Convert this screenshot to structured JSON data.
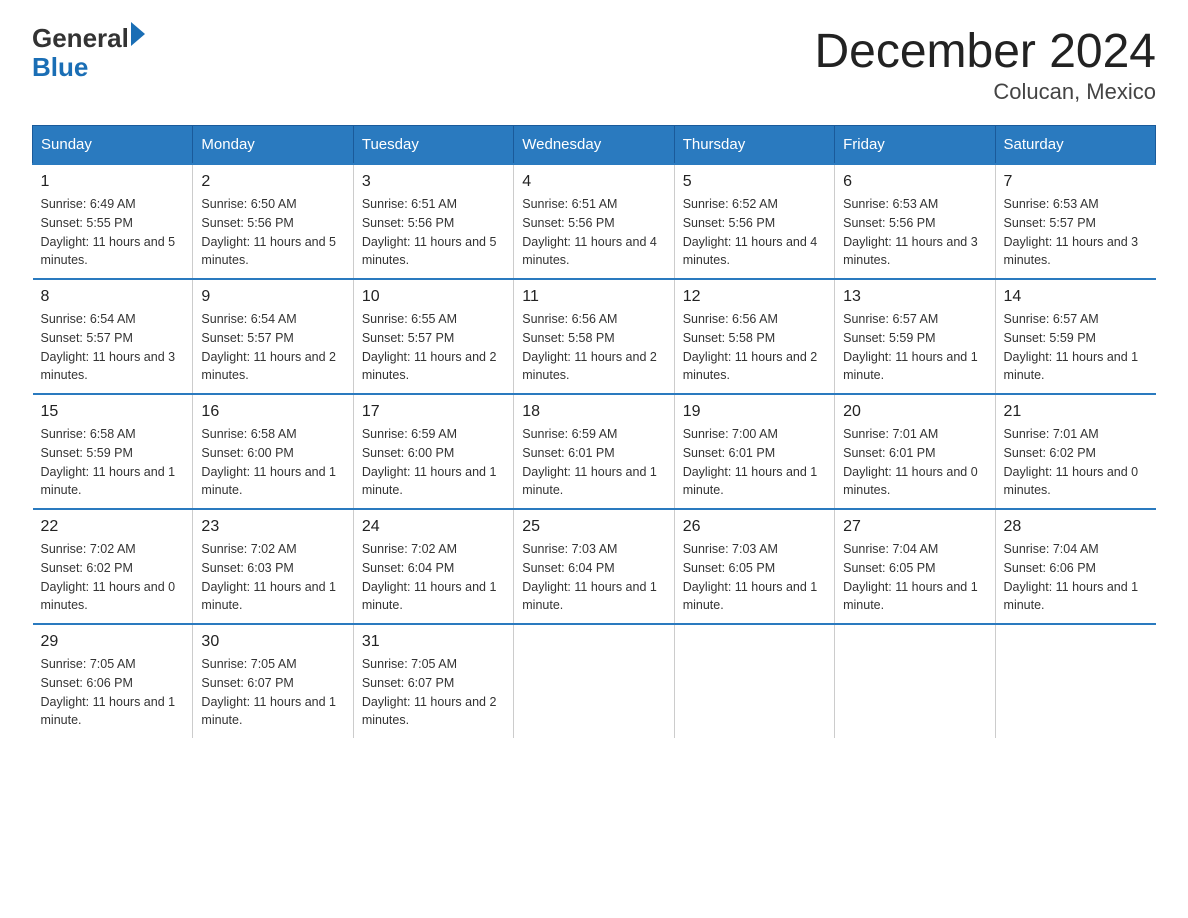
{
  "logo": {
    "general": "General",
    "blue": "Blue"
  },
  "title": "December 2024",
  "subtitle": "Colucan, Mexico",
  "days_of_week": [
    "Sunday",
    "Monday",
    "Tuesday",
    "Wednesday",
    "Thursday",
    "Friday",
    "Saturday"
  ],
  "weeks": [
    [
      {
        "num": "1",
        "sunrise": "6:49 AM",
        "sunset": "5:55 PM",
        "daylight": "11 hours and 5 minutes."
      },
      {
        "num": "2",
        "sunrise": "6:50 AM",
        "sunset": "5:56 PM",
        "daylight": "11 hours and 5 minutes."
      },
      {
        "num": "3",
        "sunrise": "6:51 AM",
        "sunset": "5:56 PM",
        "daylight": "11 hours and 5 minutes."
      },
      {
        "num": "4",
        "sunrise": "6:51 AM",
        "sunset": "5:56 PM",
        "daylight": "11 hours and 4 minutes."
      },
      {
        "num": "5",
        "sunrise": "6:52 AM",
        "sunset": "5:56 PM",
        "daylight": "11 hours and 4 minutes."
      },
      {
        "num": "6",
        "sunrise": "6:53 AM",
        "sunset": "5:56 PM",
        "daylight": "11 hours and 3 minutes."
      },
      {
        "num": "7",
        "sunrise": "6:53 AM",
        "sunset": "5:57 PM",
        "daylight": "11 hours and 3 minutes."
      }
    ],
    [
      {
        "num": "8",
        "sunrise": "6:54 AM",
        "sunset": "5:57 PM",
        "daylight": "11 hours and 3 minutes."
      },
      {
        "num": "9",
        "sunrise": "6:54 AM",
        "sunset": "5:57 PM",
        "daylight": "11 hours and 2 minutes."
      },
      {
        "num": "10",
        "sunrise": "6:55 AM",
        "sunset": "5:57 PM",
        "daylight": "11 hours and 2 minutes."
      },
      {
        "num": "11",
        "sunrise": "6:56 AM",
        "sunset": "5:58 PM",
        "daylight": "11 hours and 2 minutes."
      },
      {
        "num": "12",
        "sunrise": "6:56 AM",
        "sunset": "5:58 PM",
        "daylight": "11 hours and 2 minutes."
      },
      {
        "num": "13",
        "sunrise": "6:57 AM",
        "sunset": "5:59 PM",
        "daylight": "11 hours and 1 minute."
      },
      {
        "num": "14",
        "sunrise": "6:57 AM",
        "sunset": "5:59 PM",
        "daylight": "11 hours and 1 minute."
      }
    ],
    [
      {
        "num": "15",
        "sunrise": "6:58 AM",
        "sunset": "5:59 PM",
        "daylight": "11 hours and 1 minute."
      },
      {
        "num": "16",
        "sunrise": "6:58 AM",
        "sunset": "6:00 PM",
        "daylight": "11 hours and 1 minute."
      },
      {
        "num": "17",
        "sunrise": "6:59 AM",
        "sunset": "6:00 PM",
        "daylight": "11 hours and 1 minute."
      },
      {
        "num": "18",
        "sunrise": "6:59 AM",
        "sunset": "6:01 PM",
        "daylight": "11 hours and 1 minute."
      },
      {
        "num": "19",
        "sunrise": "7:00 AM",
        "sunset": "6:01 PM",
        "daylight": "11 hours and 1 minute."
      },
      {
        "num": "20",
        "sunrise": "7:01 AM",
        "sunset": "6:01 PM",
        "daylight": "11 hours and 0 minutes."
      },
      {
        "num": "21",
        "sunrise": "7:01 AM",
        "sunset": "6:02 PM",
        "daylight": "11 hours and 0 minutes."
      }
    ],
    [
      {
        "num": "22",
        "sunrise": "7:02 AM",
        "sunset": "6:02 PM",
        "daylight": "11 hours and 0 minutes."
      },
      {
        "num": "23",
        "sunrise": "7:02 AM",
        "sunset": "6:03 PM",
        "daylight": "11 hours and 1 minute."
      },
      {
        "num": "24",
        "sunrise": "7:02 AM",
        "sunset": "6:04 PM",
        "daylight": "11 hours and 1 minute."
      },
      {
        "num": "25",
        "sunrise": "7:03 AM",
        "sunset": "6:04 PM",
        "daylight": "11 hours and 1 minute."
      },
      {
        "num": "26",
        "sunrise": "7:03 AM",
        "sunset": "6:05 PM",
        "daylight": "11 hours and 1 minute."
      },
      {
        "num": "27",
        "sunrise": "7:04 AM",
        "sunset": "6:05 PM",
        "daylight": "11 hours and 1 minute."
      },
      {
        "num": "28",
        "sunrise": "7:04 AM",
        "sunset": "6:06 PM",
        "daylight": "11 hours and 1 minute."
      }
    ],
    [
      {
        "num": "29",
        "sunrise": "7:05 AM",
        "sunset": "6:06 PM",
        "daylight": "11 hours and 1 minute."
      },
      {
        "num": "30",
        "sunrise": "7:05 AM",
        "sunset": "6:07 PM",
        "daylight": "11 hours and 1 minute."
      },
      {
        "num": "31",
        "sunrise": "7:05 AM",
        "sunset": "6:07 PM",
        "daylight": "11 hours and 2 minutes."
      },
      null,
      null,
      null,
      null
    ]
  ]
}
